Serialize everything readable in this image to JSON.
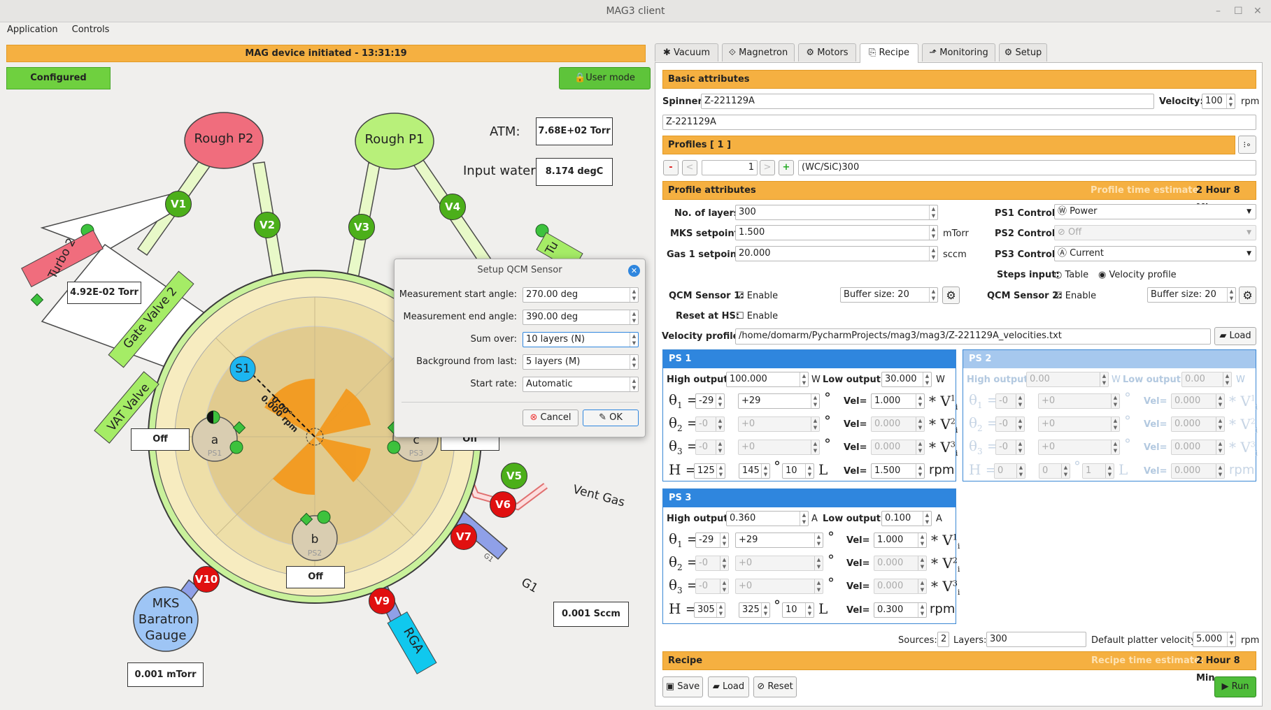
{
  "window": {
    "title": "MAG3 client",
    "controls": [
      "–",
      "☐",
      "✕"
    ]
  },
  "menu": [
    "Application",
    "Controls"
  ],
  "left": {
    "status_banner": "MAG device initiated - 13:31:19",
    "configured": "Configured",
    "user_mode": "User mode",
    "atm_label": "ATM:",
    "atm_value": "7.68E+02 Torr",
    "water_label": "Input water:",
    "water_value": "8.174 degC",
    "rough_p2": "Rough P2",
    "rough_p1": "Rough P1",
    "turbo2": "Turbo 2",
    "turbo2_value": "4.92E-02 Torr",
    "turbo_partial": "Tu",
    "gate_valve": "Gate Valve 2",
    "vat_valve": "VAT Valve",
    "valves": [
      "V1",
      "V2",
      "V3",
      "V4",
      "V5",
      "V6",
      "V7",
      "V9",
      "V10"
    ],
    "s1": "S1",
    "angle_label": "0.00°",
    "rpm_label": "0.000 rpm",
    "sources": [
      {
        "letter": "a",
        "ps": "PS1",
        "state": "Off"
      },
      {
        "letter": "b",
        "ps": "PS2",
        "state": "Off"
      },
      {
        "letter": "c",
        "ps": "PS3",
        "state": "Off"
      }
    ],
    "vent_gas": "Vent Gas",
    "g1": "G1",
    "g1_value": "0.001 Sccm",
    "rga": "RGA",
    "mks_gauge": "MKS Baratron Gauge",
    "mks_value": "0.001 mTorr",
    "colors": {
      "valve_open": "#4caf1a",
      "valve_closed": "#e01010",
      "rough_p2": "#f06d7d",
      "rough_p1": "#b8f07a"
    }
  },
  "dialog": {
    "title": "Setup QCM Sensor",
    "rows": [
      {
        "label": "Measurement start angle:",
        "value": "270.00 deg"
      },
      {
        "label": "Measurement end angle:",
        "value": "390.00 deg"
      },
      {
        "label": "Sum over:",
        "value": "10 layers (N)"
      },
      {
        "label": "Background from last:",
        "value": "5 layers (M)"
      },
      {
        "label": "Start rate:",
        "value": "Automatic"
      }
    ],
    "cancel": "Cancel",
    "ok": "OK"
  },
  "tabs": [
    "Vacuum",
    "Magnetron",
    "Motors",
    "Recipe",
    "Monitoring",
    "Setup"
  ],
  "active_tab": "Recipe",
  "recipe": {
    "basic_attributes": "Basic attributes",
    "spinner_label": "Spinner:",
    "spinner_value": "Z-221129A",
    "velocity_label": "Velocity:",
    "velocity_value": "100",
    "velocity_unit": "rpm",
    "spinner_desc": "Z-221129A",
    "profiles_header": "Profiles [ 1 ]",
    "profile_index": "1",
    "profile_name": "(WC/SiC)300",
    "profile_attributes": "Profile attributes",
    "profile_time_label": "Profile time estimate:",
    "profile_time_value": "2 Hour 8 Min",
    "layers_label": "No. of layers:",
    "layers_value": "300",
    "mks_label": "MKS setpoint:",
    "mks_value": "1.500",
    "mks_unit": "mTorr",
    "gas1_label": "Gas 1 setpoint:",
    "gas1_value": "20.000",
    "gas1_unit": "sccm",
    "ps1_control_label": "PS1 Control:",
    "ps1_control_value": "Power",
    "ps2_control_label": "PS2 Control:",
    "ps2_control_value": "Off",
    "ps3_control_label": "PS3 Control:",
    "ps3_control_value": "Current",
    "steps_label": "Steps input:",
    "steps_table": "Table",
    "steps_velocity": "Velocity profile",
    "qcm1_label": "QCM Sensor 1:",
    "qcm2_label": "QCM Sensor 2:",
    "enable": "Enable",
    "buffer1": "Buffer size: 20",
    "buffer2": "Buffer size: 20",
    "reset_label": "Reset at HS:",
    "velprof_label": "Velocity profile:",
    "velprof_path": "/home/domarm/PycharmProjects/mag3/mag3/Z-221129A_velocities.txt",
    "load": "Load",
    "ps": [
      {
        "name": "PS 1",
        "high_label": "High output:",
        "high": "100.000",
        "high_unit": "W",
        "low_label": "Low output:",
        "low": "30.000",
        "low_unit": "W",
        "rows": [
          [
            "-29",
            "+29",
            "1.000"
          ],
          [
            "-0",
            "+0",
            "0.000"
          ],
          [
            "-0",
            "+0",
            "0.000"
          ]
        ],
        "h": [
          "125",
          "145",
          "10",
          "1.500"
        ]
      },
      {
        "name": "PS 2",
        "high_label": "High output:",
        "high": "0.00",
        "high_unit": "W",
        "low_label": "Low output:",
        "low": "0.00",
        "low_unit": "W",
        "rows": [
          [
            "-0",
            "+0",
            "0.000"
          ],
          [
            "-0",
            "+0",
            "0.000"
          ],
          [
            "-0",
            "+0",
            "0.000"
          ]
        ],
        "h": [
          "0",
          "0",
          "1",
          "0.000"
        ]
      },
      {
        "name": "PS 3",
        "high_label": "High output:",
        "high": "0.360",
        "high_unit": "A",
        "low_label": "Low output:",
        "low": "0.100",
        "low_unit": "A",
        "rows": [
          [
            "-29",
            "+29",
            "1.000"
          ],
          [
            "-0",
            "+0",
            "0.000"
          ],
          [
            "-0",
            "+0",
            "0.000"
          ]
        ],
        "h": [
          "305",
          "325",
          "10",
          "0.300"
        ]
      }
    ],
    "vel_label": "Vel=",
    "rpm": "rpm",
    "sources_label": "Sources:",
    "sources_value": "2",
    "layers2_label": "Layers:",
    "layers2_value": "300",
    "platter_label": "Default platter velocity:",
    "platter_value": "5.000",
    "recipe_header": "Recipe",
    "recipe_time_label": "Recipe time estimate:",
    "recipe_time_value": "2 Hour 8 Min",
    "save": "Save",
    "load2": "Load",
    "reset": "Reset",
    "run": "Run"
  }
}
